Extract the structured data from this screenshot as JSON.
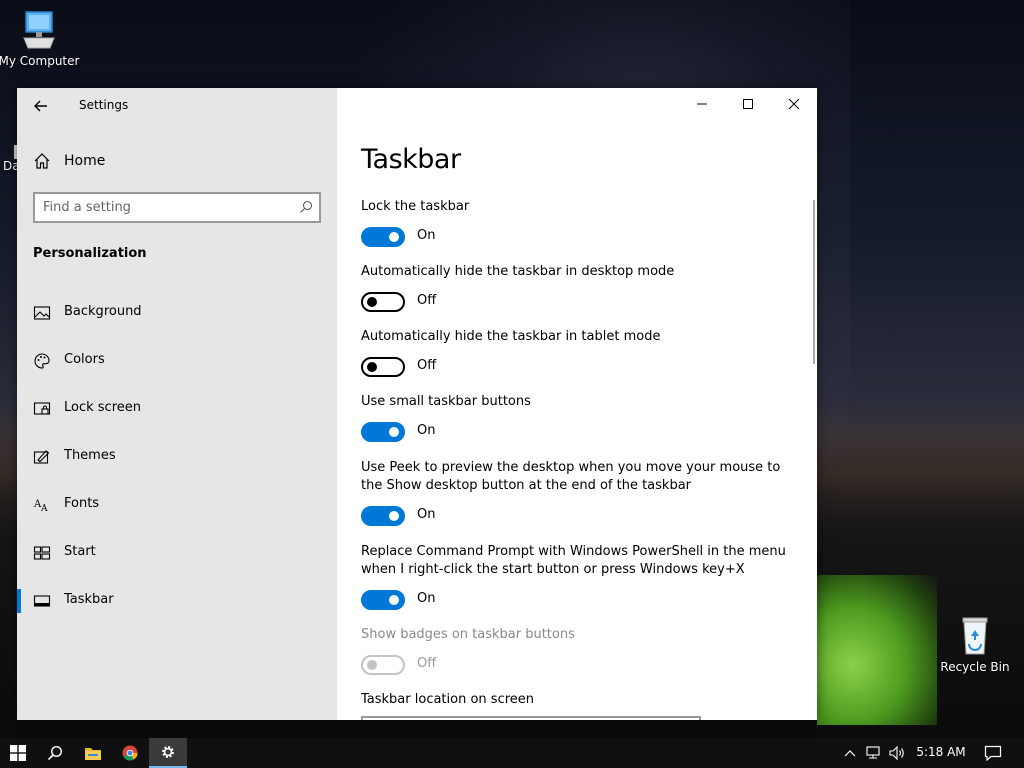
{
  "desktop": {
    "icons": [
      {
        "label": "My Computer"
      },
      {
        "label": "Recycle Bin"
      }
    ],
    "partial_label": "Da"
  },
  "window": {
    "title": "Settings",
    "controls": [
      "minimize",
      "maximize",
      "close"
    ]
  },
  "sidebar": {
    "home_label": "Home",
    "search_placeholder": "Find a setting",
    "section_title": "Personalization",
    "items": [
      {
        "label": "Background",
        "icon": "picture-icon"
      },
      {
        "label": "Colors",
        "icon": "palette-icon"
      },
      {
        "label": "Lock screen",
        "icon": "lock-screen-icon"
      },
      {
        "label": "Themes",
        "icon": "themes-icon"
      },
      {
        "label": "Fonts",
        "icon": "fonts-icon"
      },
      {
        "label": "Start",
        "icon": "start-icon"
      },
      {
        "label": "Taskbar",
        "icon": "taskbar-icon",
        "active": true
      }
    ]
  },
  "main": {
    "title": "Taskbar",
    "settings": [
      {
        "title": "Lock the taskbar",
        "state": "On"
      },
      {
        "title": "Automatically hide the taskbar in desktop mode",
        "state": "Off"
      },
      {
        "title": "Automatically hide the taskbar in tablet mode",
        "state": "Off"
      },
      {
        "title": "Use small taskbar buttons",
        "state": "On"
      },
      {
        "title": "Use Peek to preview the desktop when you move your mouse to the Show desktop button at the end of the taskbar",
        "state": "On"
      },
      {
        "title": "Replace Command Prompt with Windows PowerShell in the menu when I right-click the start button or press Windows key+X",
        "state": "On"
      },
      {
        "title": "Show badges on taskbar buttons",
        "state": "Off",
        "disabled": true
      }
    ],
    "location_label": "Taskbar location on screen"
  },
  "taskbar": {
    "time": "5:18 AM",
    "accent": "#0078d7"
  }
}
